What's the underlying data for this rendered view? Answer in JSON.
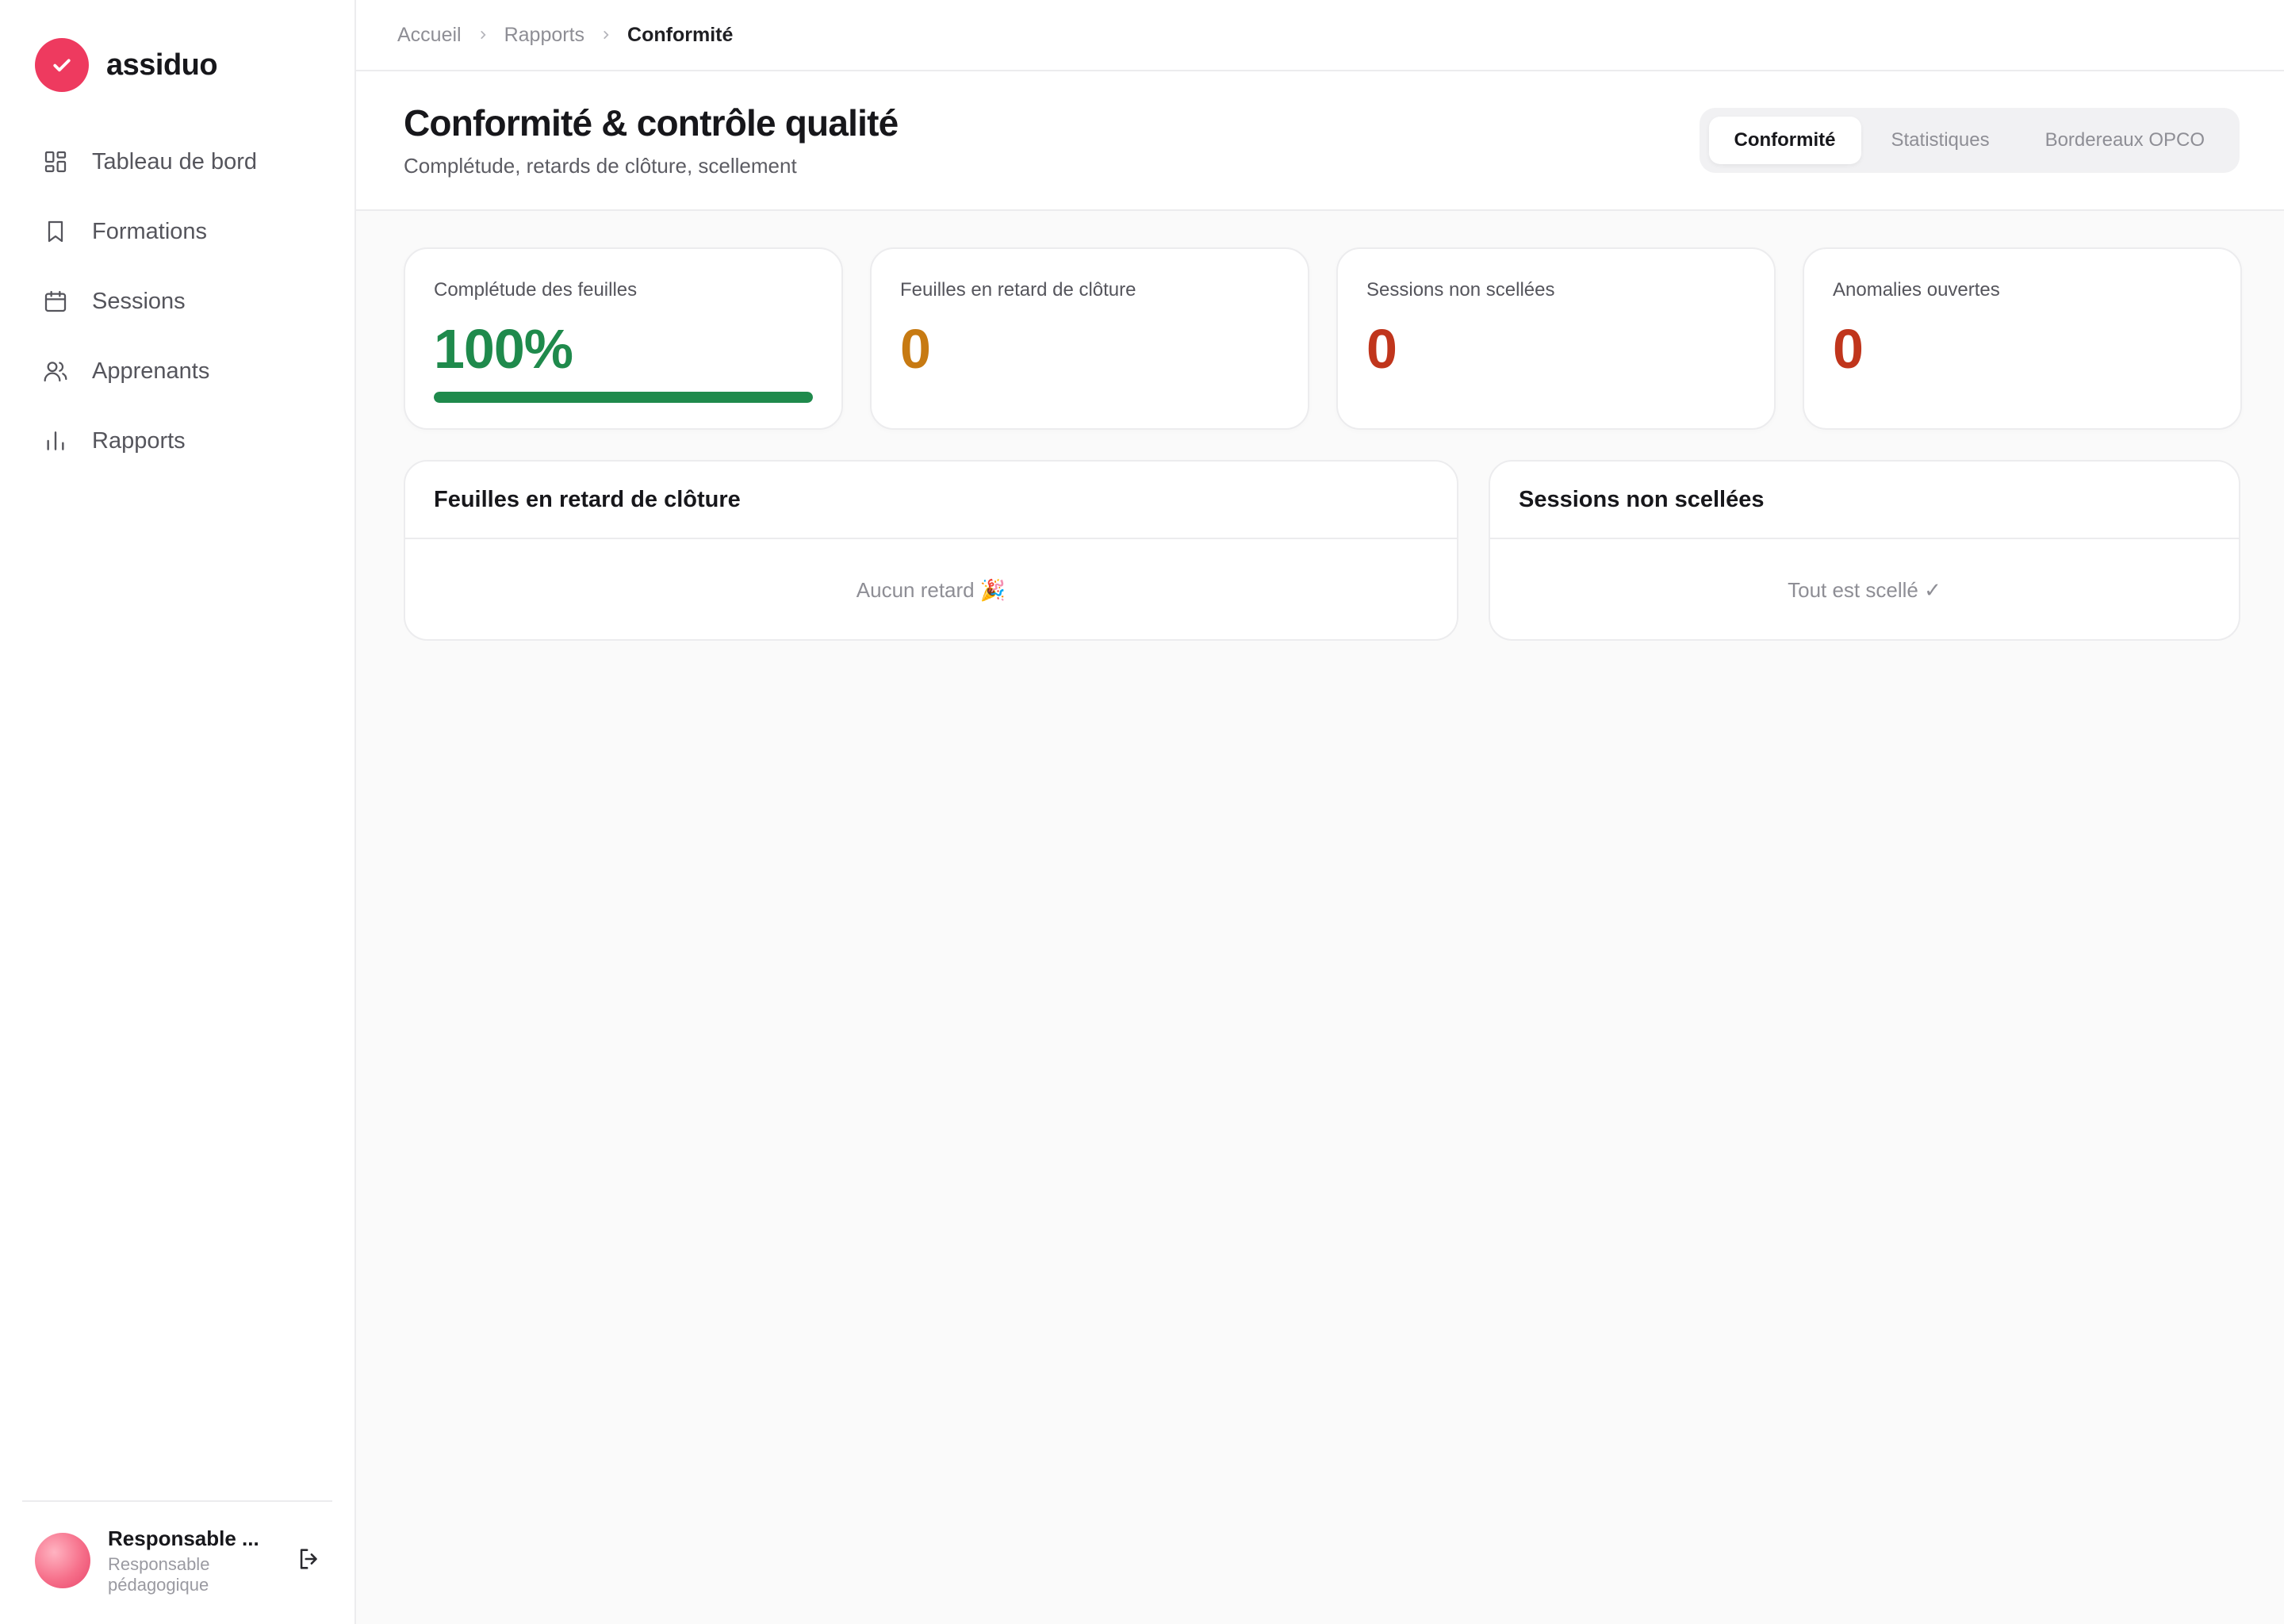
{
  "brand": {
    "name": "assiduo",
    "logo_icon": "check-icon",
    "accent": "#ee3a5f"
  },
  "sidebar": {
    "items": [
      {
        "label": "Tableau de bord",
        "icon": "dashboard-grid-icon"
      },
      {
        "label": "Formations",
        "icon": "bookmark-icon"
      },
      {
        "label": "Sessions",
        "icon": "calendar-icon"
      },
      {
        "label": "Apprenants",
        "icon": "users-icon"
      },
      {
        "label": "Rapports",
        "icon": "bar-chart-icon"
      }
    ],
    "user": {
      "name": "Responsable ...",
      "role": "Responsable pédagogique",
      "logout_icon": "logout-icon"
    }
  },
  "breadcrumb": {
    "items": [
      "Accueil",
      "Rapports",
      "Conformité"
    ]
  },
  "header": {
    "title": "Conformité & contrôle qualité",
    "subtitle": "Complétude, retards de clôture, scellement",
    "tabs": [
      "Conformité",
      "Statistiques",
      "Bordereaux OPCO"
    ],
    "active_tab": "Conformité"
  },
  "kpis": [
    {
      "label": "Complétude des feuilles",
      "value": "100%",
      "color": "#1f8a4c",
      "progress": 1.0
    },
    {
      "label": "Feuilles en retard de clôture",
      "value": "0",
      "color": "#c77a12"
    },
    {
      "label": "Sessions non scellées",
      "value": "0",
      "color": "#c0351c"
    },
    {
      "label": "Anomalies ouvertes",
      "value": "0",
      "color": "#c0351c"
    }
  ],
  "panels": {
    "late": {
      "title": "Feuilles en retard de clôture",
      "empty": "Aucun retard 🎉"
    },
    "unsealed": {
      "title": "Sessions non scellées",
      "empty": "Tout est scellé ✓"
    }
  }
}
